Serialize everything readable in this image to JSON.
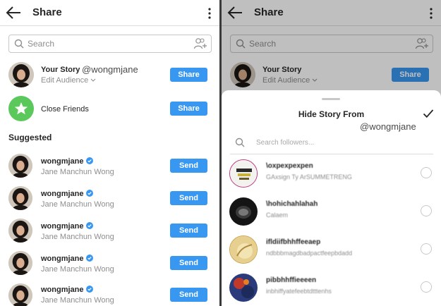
{
  "watermark": "@wongmjane",
  "left": {
    "header": {
      "title": "Share"
    },
    "search": {
      "placeholder": "Search"
    },
    "your_story": {
      "title": "Your Story",
      "edit_audience": "Edit Audience",
      "button": "Share"
    },
    "close_friends": {
      "title": "Close Friends",
      "button": "Share"
    },
    "suggested_heading": "Suggested",
    "suggested": [
      {
        "name": "wongmjane",
        "fullname": "Jane Manchun Wong",
        "button": "Send"
      },
      {
        "name": "wongmjane",
        "fullname": "Jane Manchun Wong",
        "button": "Send"
      },
      {
        "name": "wongmjane",
        "fullname": "Jane Manchun Wong",
        "button": "Send"
      },
      {
        "name": "wongmjane",
        "fullname": "Jane Manchun Wong",
        "button": "Send"
      },
      {
        "name": "wongmjane",
        "fullname": "Jane Manchun Wong",
        "button": "Send"
      }
    ]
  },
  "right": {
    "header": {
      "title": "Share"
    },
    "search": {
      "placeholder": "Search"
    },
    "your_story": {
      "title": "Your Story",
      "edit_audience": "Edit Audience",
      "button": "Share"
    },
    "sheet": {
      "title": "Hide Story From",
      "search_placeholder": "Search followers...",
      "followers": [
        {
          "name": "\\oxpexpexpen",
          "sub": "GAxsign Ty ArSUMMETRENG"
        },
        {
          "name": "\\hohichahlahah",
          "sub": "Calaem"
        },
        {
          "name": "ifldiifbhhffeeaep",
          "sub": "ndbbbmagdbadpactfeepbdadd"
        },
        {
          "name": "pibbhhffieeeen",
          "sub": "inbhiffyatefeebtdtttenhs"
        }
      ]
    }
  },
  "colors": {
    "accent": "#3897f0",
    "close_friends": "#5ac85a"
  }
}
